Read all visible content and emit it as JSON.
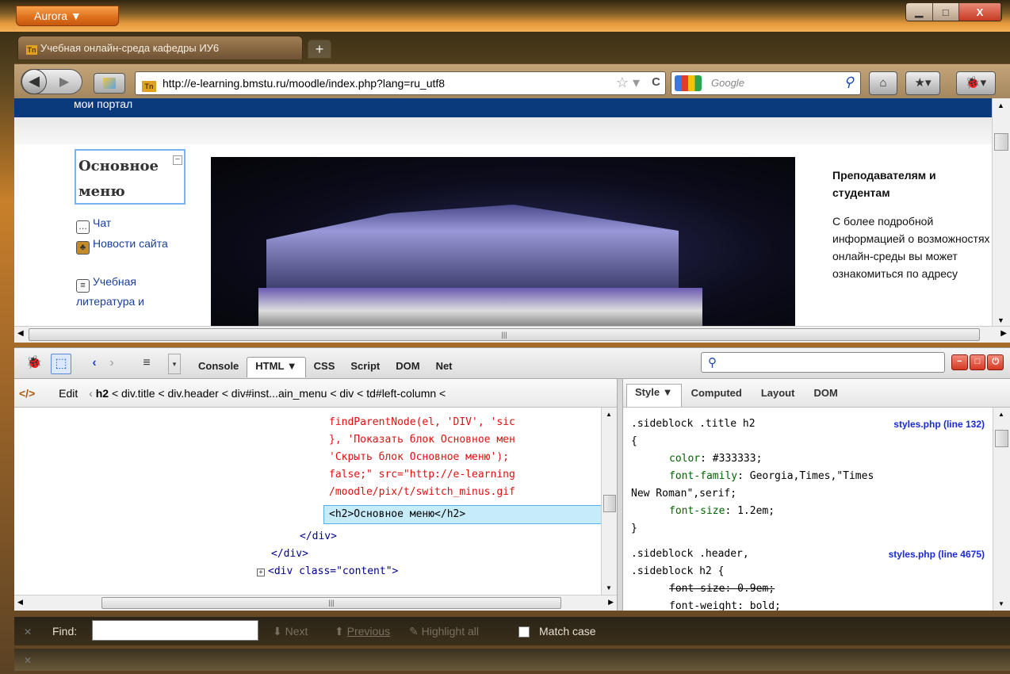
{
  "window": {
    "app_button": "Aurora ▼",
    "minimize": "▁",
    "maximize": "□",
    "close": "X"
  },
  "tabs": [
    {
      "label": "Учебная онлайн-среда кафедры ИУ6"
    }
  ],
  "navbar": {
    "url": "http://e-learning.bmstu.ru/moodle/index.php?lang=ru_utf8",
    "search_placeholder": "Google"
  },
  "page": {
    "top_bar_text": "мои портал",
    "menu_title": "Основное меню",
    "menu_items": [
      {
        "label": "Чат"
      },
      {
        "label": "Новости сайта"
      },
      {
        "label": "Учебная литература и"
      }
    ],
    "right_heading": "Преподавателям и студентам",
    "right_text": "С более подробной информацией о возможностях онлайн-среды вы может ознакомиться по адресу"
  },
  "firebug": {
    "tabs": [
      "Console",
      "HTML ▼",
      "CSS",
      "Script",
      "DOM",
      "Net"
    ],
    "breadcrumb": {
      "edit": "Edit",
      "first": "h2",
      "rest": "< div.title < div.header < div#inst...ain_menu < div < td#left-column <"
    },
    "html_lines": [
      "findParentNode(el, 'DIV', 'sic",
      "}, 'Показать блок Основное мен",
      "'Скрыть блок Основное меню');",
      "false;\" src=\"http://e-learning",
      "/moodle/pix/t/switch_minus.gif",
      "<h2>Основное меню</h2>",
      "</div>",
      "</div>",
      "<div class=\"content\">"
    ],
    "style_tabs": [
      "Style ▼",
      "Computed",
      "Layout",
      "DOM"
    ],
    "rule1": {
      "selector": ".sideblock .title h2",
      "source": "styles.php (line 132)",
      "color_prop": "color",
      "color_val": "#333333;",
      "font_prop": "font-family",
      "font_val": "Georgia,Times,\"Times",
      "font_val2": "New Roman\",serif;",
      "size_prop": "font-size",
      "size_val": "1.2em;"
    },
    "rule2": {
      "selector": ".sideblock .header,",
      "selector2": ".sideblock h2 {",
      "source": "styles.php (line 4675)",
      "overridden": "font-size: 0.9em;",
      "weight": "font-weight: bold;"
    }
  },
  "findbar": {
    "label": "Find:",
    "next": "Next",
    "previous": "Previous",
    "highlight": "Highlight all",
    "match_case": "Match case"
  }
}
